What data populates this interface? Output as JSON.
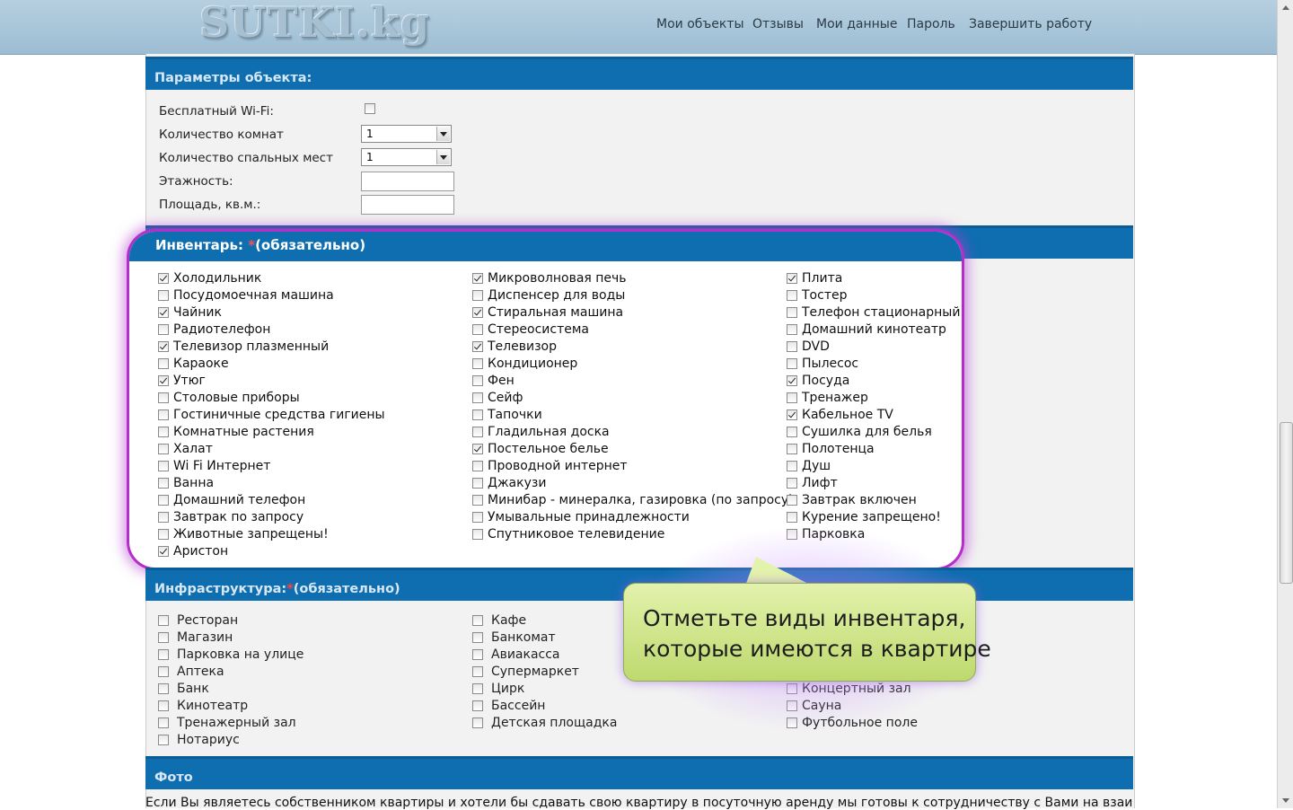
{
  "header": {
    "logo_text": "SUTKI.kg",
    "nav": [
      "Мои объекты",
      "Отзывы",
      "Мои данные",
      "Пароль",
      "Завершить работу"
    ]
  },
  "params": {
    "title": "Параметры объекта:",
    "wifi_label": "Бесплатный Wi-Fi:",
    "wifi_checked": false,
    "rooms_label": "Количество комнат",
    "rooms_value": "1",
    "beds_label": "Количество спальных мест",
    "beds_value": "1",
    "floors_label": "Этажность:",
    "floors_value": "",
    "area_label": "Площадь, кв.м.:",
    "area_value": ""
  },
  "inventory": {
    "title": "Инвентарь:",
    "required_mark": "*",
    "required_text": "(обязательно)",
    "columns": [
      [
        {
          "label": "Холодильник",
          "checked": true
        },
        {
          "label": "Посудомоечная машина",
          "checked": false
        },
        {
          "label": "Чайник",
          "checked": true
        },
        {
          "label": "Радиотелефон",
          "checked": false
        },
        {
          "label": "Телевизор плазменный",
          "checked": true
        },
        {
          "label": "Караоке",
          "checked": false
        },
        {
          "label": "Утюг",
          "checked": true
        },
        {
          "label": "Столовые приборы",
          "checked": false
        },
        {
          "label": "Гостиничные средства гигиены",
          "checked": false
        },
        {
          "label": "Комнатные растения",
          "checked": false
        },
        {
          "label": "Халат",
          "checked": false
        },
        {
          "label": "Wi Fi Интернет",
          "checked": false
        },
        {
          "label": "Ванна",
          "checked": false
        },
        {
          "label": "Домашний телефон",
          "checked": false
        },
        {
          "label": "Завтрак по запросу",
          "checked": false
        },
        {
          "label": "Животные запрещены!",
          "checked": false
        },
        {
          "label": "Аристон",
          "checked": true
        }
      ],
      [
        {
          "label": "Микроволновая печь",
          "checked": true
        },
        {
          "label": "Диспенсер для воды",
          "checked": false
        },
        {
          "label": "Стиральная машина",
          "checked": true
        },
        {
          "label": "Стереосистема",
          "checked": false
        },
        {
          "label": "Телевизор",
          "checked": true
        },
        {
          "label": "Кондиционер",
          "checked": false
        },
        {
          "label": "Фен",
          "checked": false
        },
        {
          "label": "Сейф",
          "checked": false
        },
        {
          "label": "Тапочки",
          "checked": false
        },
        {
          "label": "Гладильная доска",
          "checked": false
        },
        {
          "label": "Постельное белье",
          "checked": true
        },
        {
          "label": "Проводной интернет",
          "checked": false
        },
        {
          "label": "Джакузи",
          "checked": false
        },
        {
          "label": "Минибар - минералка, газировка (по запросу)",
          "checked": false
        },
        {
          "label": "Умывальные принадлежности",
          "checked": false
        },
        {
          "label": "Спутниковое телевидение",
          "checked": false
        }
      ],
      [
        {
          "label": "Плита",
          "checked": true
        },
        {
          "label": "Тостер",
          "checked": false
        },
        {
          "label": "Телефон стационарный",
          "checked": false
        },
        {
          "label": "Домашний кинотеатр",
          "checked": false
        },
        {
          "label": "DVD",
          "checked": false
        },
        {
          "label": "Пылесос",
          "checked": false
        },
        {
          "label": "Посуда",
          "checked": true
        },
        {
          "label": "Тренажер",
          "checked": false
        },
        {
          "label": "Кабельное TV",
          "checked": true
        },
        {
          "label": "Сушилка для белья",
          "checked": false
        },
        {
          "label": "Полотенца",
          "checked": false
        },
        {
          "label": "Душ",
          "checked": false
        },
        {
          "label": "Лифт",
          "checked": false
        },
        {
          "label": "Завтрак включен",
          "checked": false
        },
        {
          "label": "Курение запрещено!",
          "checked": false
        },
        {
          "label": "Парковка",
          "checked": false
        }
      ]
    ]
  },
  "infrastructure": {
    "title": "Инфраструктура:",
    "required_mark": "*",
    "required_text": "(обязательно)",
    "columns": [
      [
        {
          "label": "Ресторан",
          "checked": false
        },
        {
          "label": "Магазин",
          "checked": false
        },
        {
          "label": "Парковка на улице",
          "checked": false
        },
        {
          "label": "Аптека",
          "checked": false
        },
        {
          "label": "Банк",
          "checked": false
        },
        {
          "label": "Кинотеатр",
          "checked": false
        },
        {
          "label": "Тренажерный зал",
          "checked": false
        },
        {
          "label": "Нотариус",
          "checked": false
        }
      ],
      [
        {
          "label": "Кафе",
          "checked": false
        },
        {
          "label": "Банкомат",
          "checked": false
        },
        {
          "label": "Авиакасса",
          "checked": false
        },
        {
          "label": "Супермаркет",
          "checked": false
        },
        {
          "label": "Цирк",
          "checked": false
        },
        {
          "label": "Бассейн",
          "checked": false
        },
        {
          "label": "Детская площадка",
          "checked": false
        }
      ],
      [
        {
          "label": "Концертный зал",
          "checked": false
        },
        {
          "label": "Сауна",
          "checked": false
        },
        {
          "label": "Футбольное поле",
          "checked": false
        }
      ]
    ]
  },
  "tooltip": {
    "line1": "Отметьте виды инвентаря,",
    "line2": "которые имеются в квартире"
  },
  "photo": {
    "title": "Фото",
    "text": "Если Вы являетесь собственником квартиры и хотели бы сдавать свою квартиру в посуточную аренду мы готовы к сотрудничеству с Вами на взаимовыгодной"
  }
}
